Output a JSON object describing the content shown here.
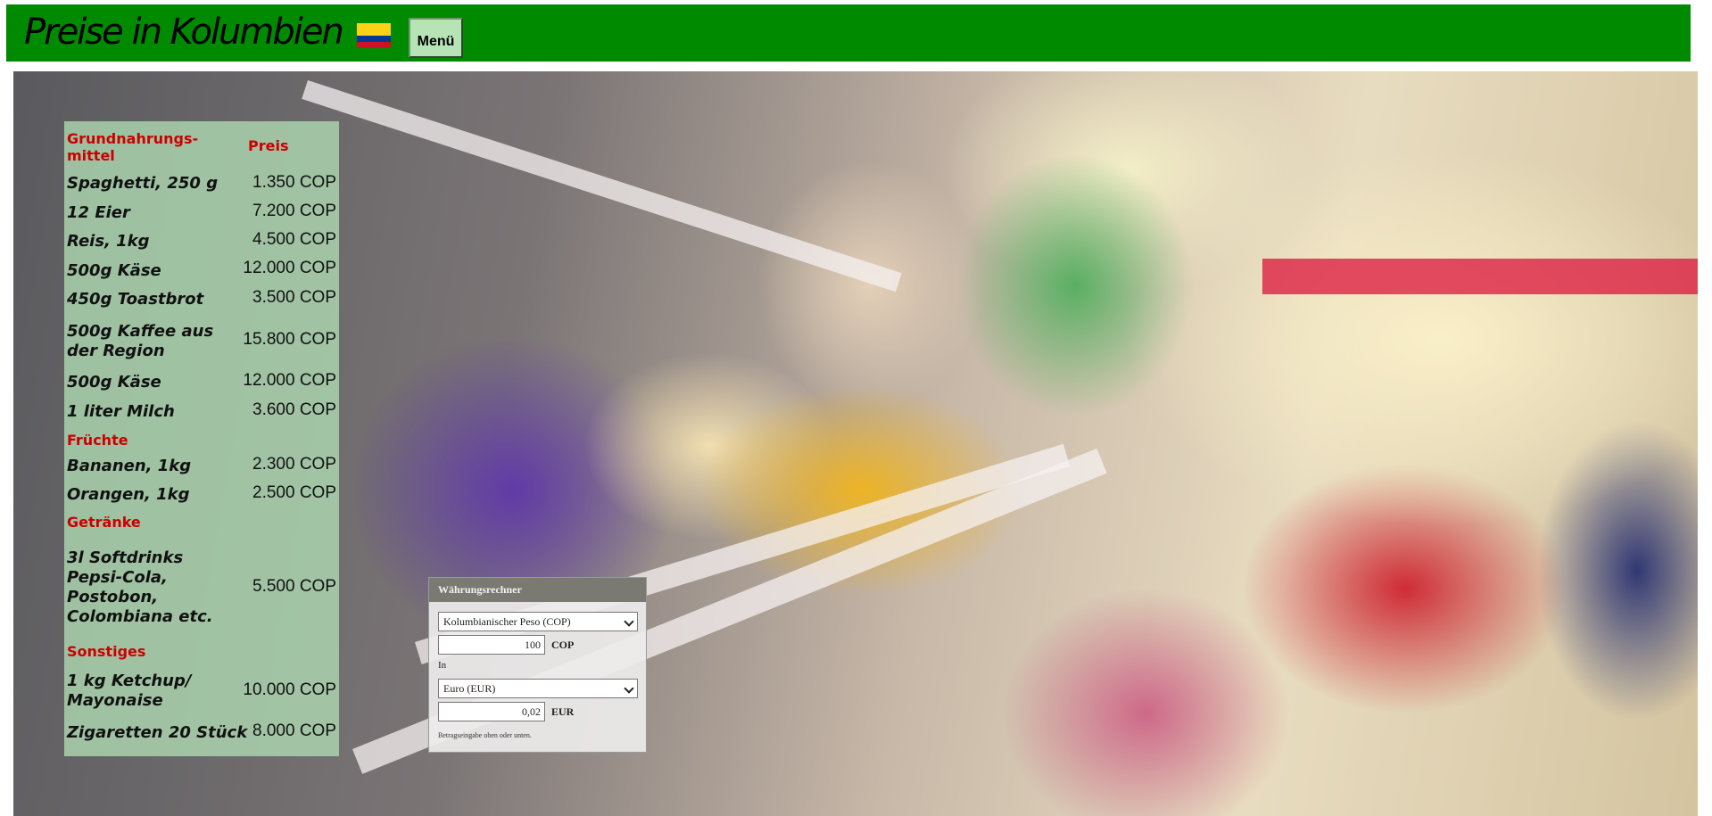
{
  "header": {
    "title": "Preise in Kolumbien",
    "flag_icon": "colombia-flag-icon",
    "flag_colors": [
      "#FCD116",
      "#003893",
      "#CE1126"
    ],
    "menu_label": "Menü",
    "bar_color": "#008a00"
  },
  "price_table": {
    "col_item": "Grundnahrungs-\nmittel",
    "col_price": "Preis",
    "sections": [
      {
        "title": "",
        "items": [
          {
            "name": "Spaghetti, 250 g",
            "price": "1.350 COP"
          },
          {
            "name": "12 Eier",
            "price": "7.200 COP"
          },
          {
            "name": "Reis, 1kg",
            "price": "4.500 COP"
          },
          {
            "name": "500g Käse",
            "price": "12.000 COP"
          },
          {
            "name": "450g Toastbrot",
            "price": "3.500 COP"
          },
          {
            "name": "500g Kaffee aus der Region",
            "price": "15.800 COP"
          },
          {
            "name": "500g Käse",
            "price": "12.000 COP"
          },
          {
            "name": "1 liter Milch",
            "price": "3.600 COP"
          }
        ]
      },
      {
        "title": "Früchte",
        "items": [
          {
            "name": "Bananen, 1kg",
            "price": "2.300 COP"
          },
          {
            "name": "Orangen, 1kg",
            "price": "2.500 COP"
          }
        ]
      },
      {
        "title": "Getränke",
        "items": [
          {
            "name": "3l Softdrinks Pepsi-Cola, Postobon, Colombiana etc.",
            "price": "5.500 COP"
          }
        ]
      },
      {
        "title": "Sonstiges",
        "items": [
          {
            "name": "1 kg Ketchup/ Mayonaise",
            "price": "10.000 COP"
          },
          {
            "name": "Zigaretten 20 Stück",
            "price": "8.000 COP"
          }
        ]
      }
    ]
  },
  "converter": {
    "title": "Währungsrechner",
    "from_currency": "Kolumbianischer Peso (COP)",
    "from_amount": "100",
    "from_code": "COP",
    "in_label": "In",
    "to_currency": "Euro (EUR)",
    "to_amount": "0,02",
    "to_code": "EUR",
    "note": "Betragseingabe oben oder unten."
  }
}
